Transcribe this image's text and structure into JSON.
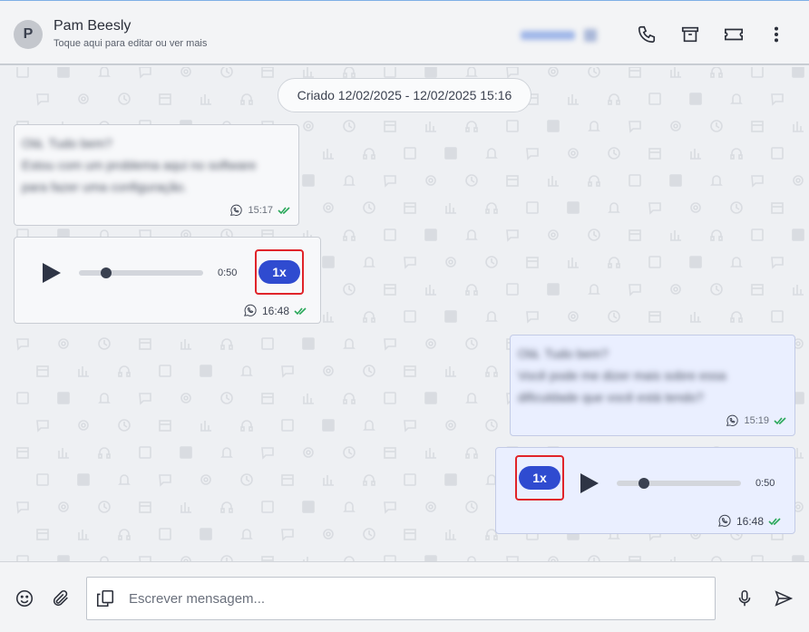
{
  "header": {
    "avatar_initial": "P",
    "contact_name": "Pam Beesly",
    "contact_subtitle": "Toque aqui para editar ou ver mais",
    "icons": [
      "phone-icon",
      "archive-icon",
      "ticket-icon",
      "more-vertical-icon"
    ]
  },
  "chat": {
    "date_pill": "Criado 12/02/2025 - 12/02/2025 15:16",
    "messages": [
      {
        "direction": "in",
        "type": "text",
        "blurred_lines": [
          "Olá. Tudo bem?",
          "Estou com um problema aqui no software",
          "para fazer uma configuração."
        ],
        "time": "15:17"
      },
      {
        "direction": "in",
        "type": "audio",
        "duration": "0:50",
        "speed": "1x",
        "progress": 0.22,
        "time": "16:48"
      },
      {
        "direction": "out",
        "type": "text",
        "blurred_lines": [
          "Olá. Tudo bem?",
          "Você pode me dizer mais sobre essa",
          "dificuldade que você está tendo?"
        ],
        "time": "15:19"
      },
      {
        "direction": "out",
        "type": "audio",
        "duration": "0:50",
        "speed": "1x",
        "progress": 0.22,
        "time": "16:48"
      }
    ]
  },
  "composer": {
    "placeholder": "Escrever mensagem...",
    "icons": [
      "emoji-icon",
      "attach-icon",
      "quick-reply-icon",
      "microphone-icon",
      "send-icon"
    ]
  },
  "colors": {
    "accent": "#2f4bd0",
    "highlight": "#e0242a",
    "read_tick": "#2aa85a"
  }
}
